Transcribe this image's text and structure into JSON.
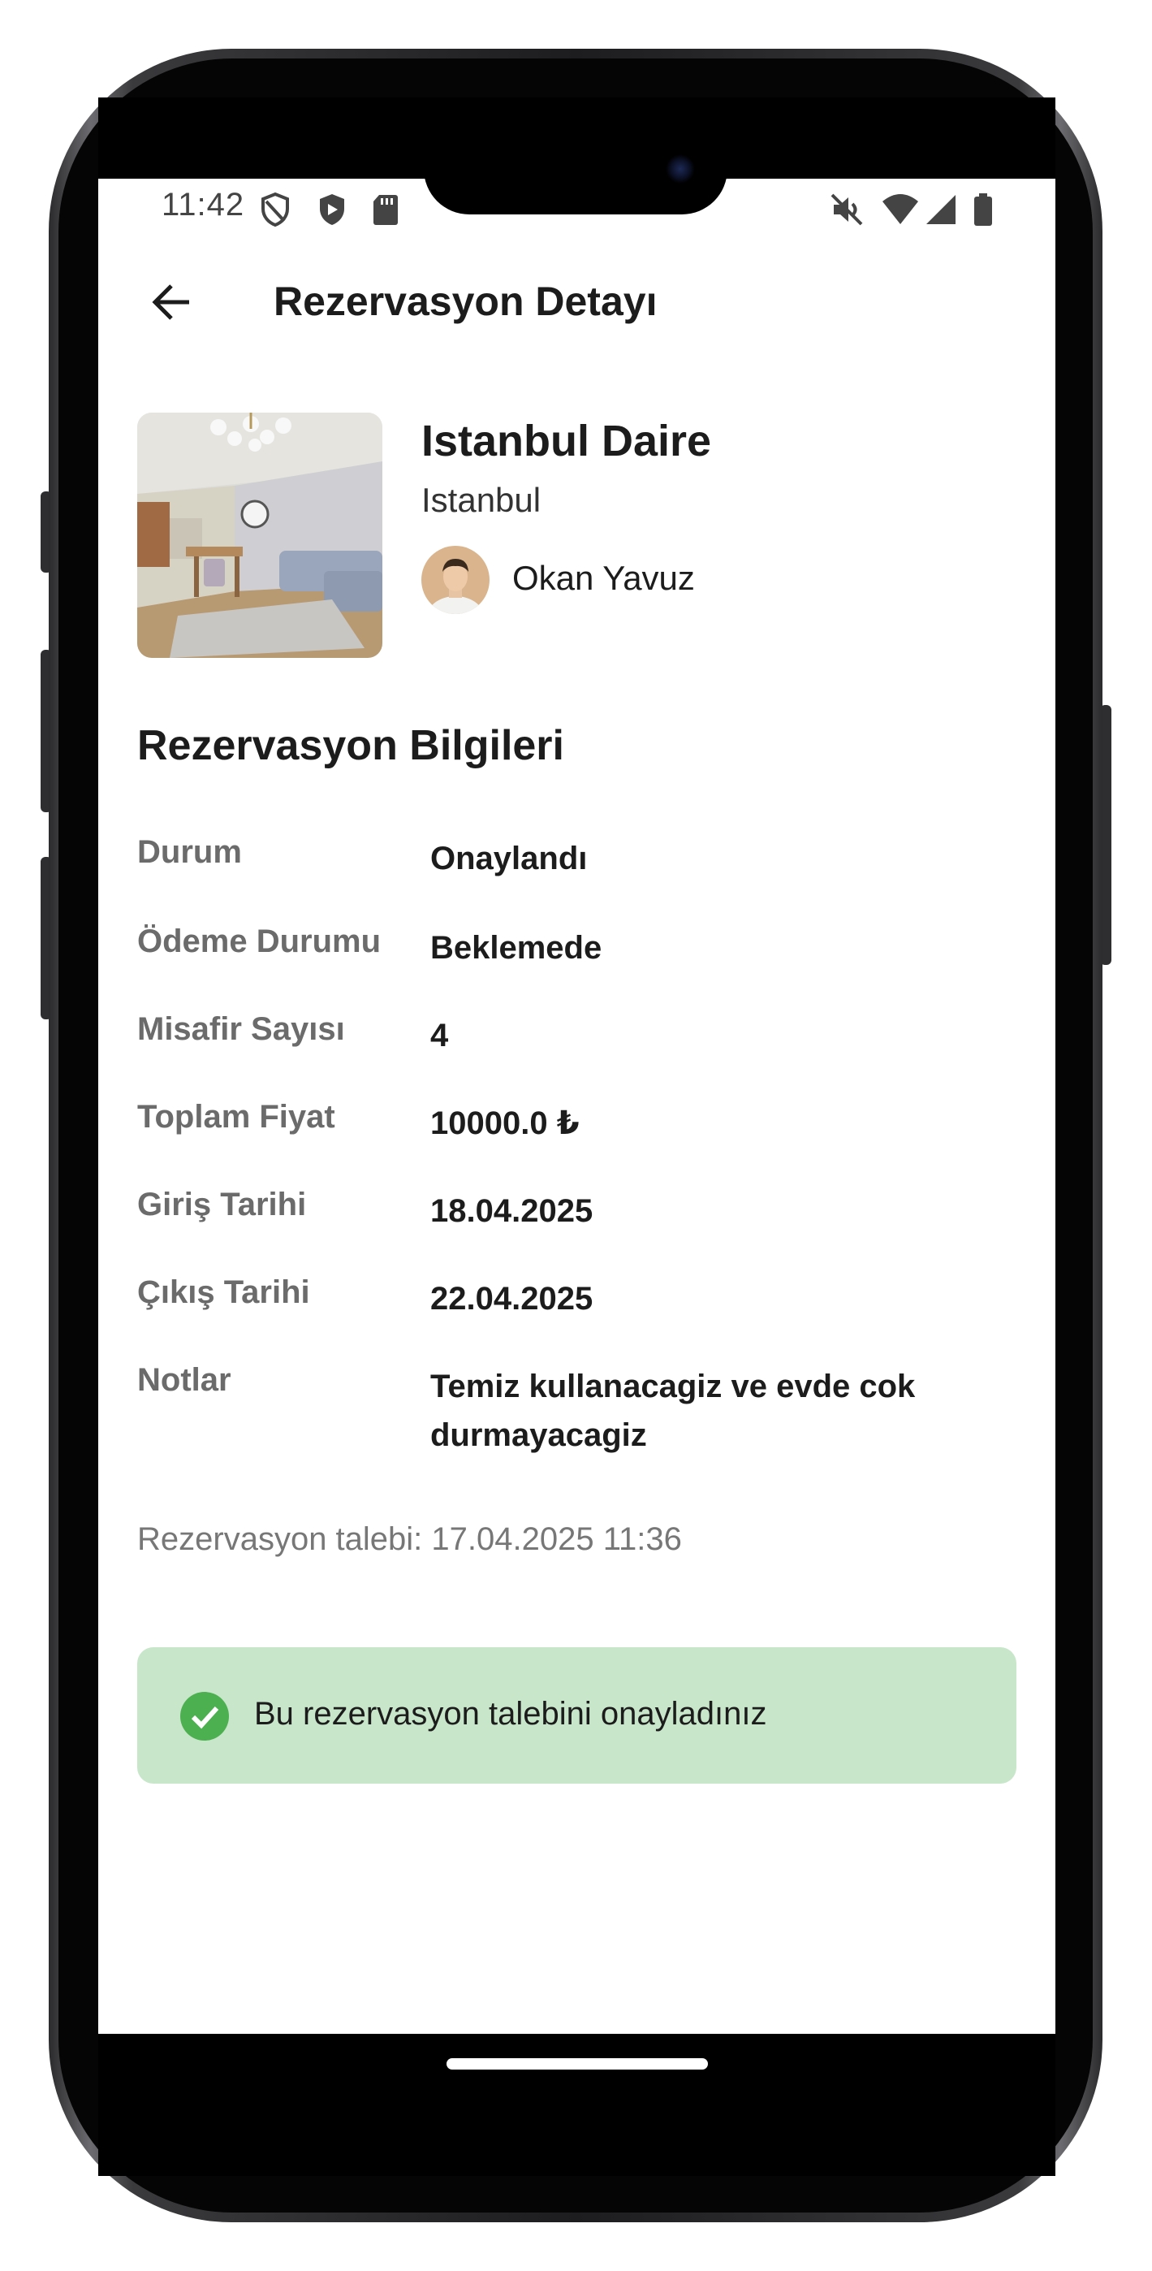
{
  "status_bar": {
    "time": "11:42",
    "left_icons": [
      "vpn-key-icon",
      "shield-icon",
      "sd-card-icon"
    ],
    "right_icons": [
      "mute-icon",
      "wifi-icon",
      "signal-icon",
      "battery-icon"
    ]
  },
  "app_bar": {
    "back_icon": "arrow-left-icon",
    "title": "Rezervasyon Detayı"
  },
  "listing": {
    "title": "Istanbul Daire",
    "city": "Istanbul",
    "host_name": "Okan Yavuz"
  },
  "reservation": {
    "section_title": "Rezervasyon Bilgileri",
    "rows": [
      {
        "label": "Durum",
        "value": "Onaylandı"
      },
      {
        "label": "Ödeme Durumu",
        "value": "Beklemede"
      },
      {
        "label": "Misafir Sayısı",
        "value": "4"
      },
      {
        "label": "Toplam Fiyat",
        "value": "10000.0 ₺"
      },
      {
        "label": "Giriş Tarihi",
        "value": "18.04.2025"
      },
      {
        "label": "Çıkış Tarihi",
        "value": "22.04.2025"
      },
      {
        "label": "Notlar",
        "value": "Temiz kullanacagiz ve evde cok durmayacagiz"
      }
    ],
    "request_time": "Rezervasyon talebi: 17.04.2025 11:36"
  },
  "confirmation": {
    "icon": "check-circle-icon",
    "text": "Bu rezervasyon talebini onayladınız",
    "background_color": "#c8e6c9",
    "icon_color": "#4caf50"
  }
}
